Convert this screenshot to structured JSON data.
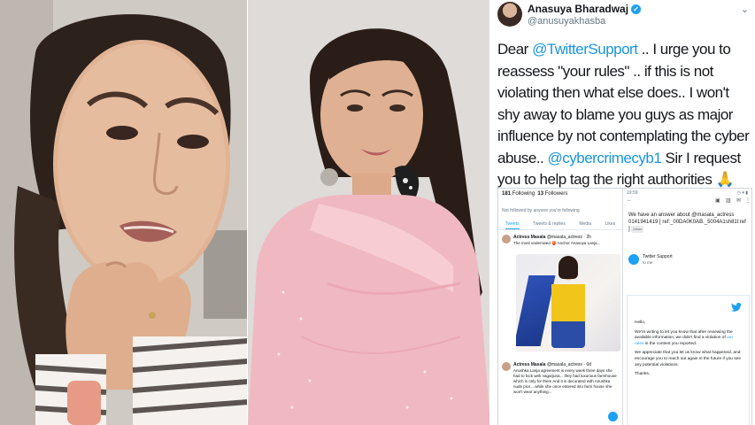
{
  "tweet": {
    "display_name": "Anasuya Bharadwaj",
    "handle": "@anusuyakhasba",
    "body_parts": [
      {
        "text": "Dear ",
        "mention": false
      },
      {
        "text": "@TwitterSupport",
        "mention": true
      },
      {
        "text": " .. I urge you to reassess \"your rules\" .. if this is not violating then what else does.. I won't shy away to blame you guys as major influence by not contemplating the cyber abuse.. ",
        "mention": false
      },
      {
        "text": "@cybercrimecyb1",
        "mention": true
      },
      {
        "text": " Sir I request you to help tag the right authorities 🙏",
        "mention": false
      }
    ]
  },
  "screenshot": {
    "profile": {
      "following_count": "181",
      "following_label": "Following",
      "followers_count": "13",
      "followers_label": "Followers",
      "note": "Not followed by anyone you're following",
      "tabs": [
        "Tweets",
        "Tweets & replies",
        "Media",
        "Likes"
      ]
    },
    "post1": {
      "name": "Actress Masala",
      "meta": "@masala_actress · 2h",
      "text": "The most underrated 🍑 Anchor Anasuya Lanja..."
    },
    "post2": {
      "name": "Actress Masala",
      "meta": "@masala_actress · 6d",
      "text": "Anushka Lanja agreement is every week three days she had to fuck with nagarjuna... they had luxurious farmhouse which is only for them And it is decorated with Anushka nude pics....while she once entered into farm house she won't wear anything..."
    },
    "email": {
      "time": "19:59",
      "status_icons": "◷ ▾ ▮",
      "subject": "We have an answer about @masala_actress 0141941419 [ ref:_00DA0K0AB._5004A1sh81l:ref ]",
      "label": "Inbox",
      "sender": "Twitter Support",
      "to": "to me",
      "greeting": "Hello,",
      "para1_pre": "We're writing to let you know that after reviewing the available information, we didn't find a violation of ",
      "para1_link": "our rules",
      "para1_post": " in the content you reported.",
      "para2": "We appreciate that you let us know what happened, and encourage you to reach out again in the future if you see any potential violations.",
      "closing": "Thanks,"
    }
  }
}
